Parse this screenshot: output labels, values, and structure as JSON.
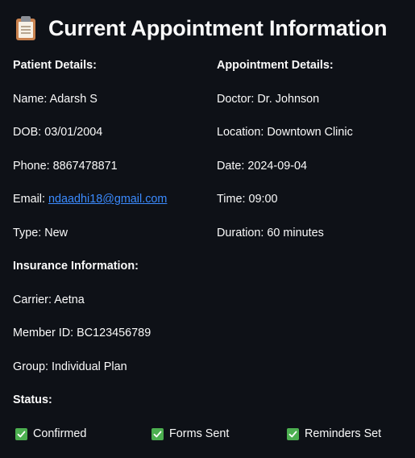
{
  "title": "Current Appointment Information",
  "title_icon": "clipboard-icon",
  "patient": {
    "heading": "Patient Details:",
    "name_label": "Name:",
    "name": "Adarsh S",
    "dob_label": "DOB:",
    "dob": "03/01/2004",
    "phone_label": "Phone:",
    "phone": "8867478871",
    "email_label": "Email:",
    "email": "ndaadhi18@gmail.com",
    "type_label": "Type:",
    "type": "New"
  },
  "appointment": {
    "heading": "Appointment Details:",
    "doctor_label": "Doctor:",
    "doctor": "Dr. Johnson",
    "location_label": "Location:",
    "location": "Downtown Clinic",
    "date_label": "Date:",
    "date": "2024-09-04",
    "time_label": "Time:",
    "time": "09:00",
    "duration_label": "Duration:",
    "duration": "60 minutes"
  },
  "insurance": {
    "heading": "Insurance Information:",
    "carrier_label": "Carrier:",
    "carrier": "Aetna",
    "member_label": "Member ID:",
    "member_id": "BC123456789",
    "group_label": "Group:",
    "group": "Individual Plan"
  },
  "status": {
    "heading": "Status:",
    "items": [
      {
        "label": "Confirmed",
        "checked": true,
        "icon": "check-icon"
      },
      {
        "label": "Forms Sent",
        "checked": true,
        "icon": "check-icon"
      },
      {
        "label": "Reminders Set",
        "checked": true,
        "icon": "check-icon"
      }
    ]
  },
  "colors": {
    "background": "#0e1117",
    "text": "#fafafa",
    "link": "#3b8bff",
    "check": "#4caf50"
  }
}
